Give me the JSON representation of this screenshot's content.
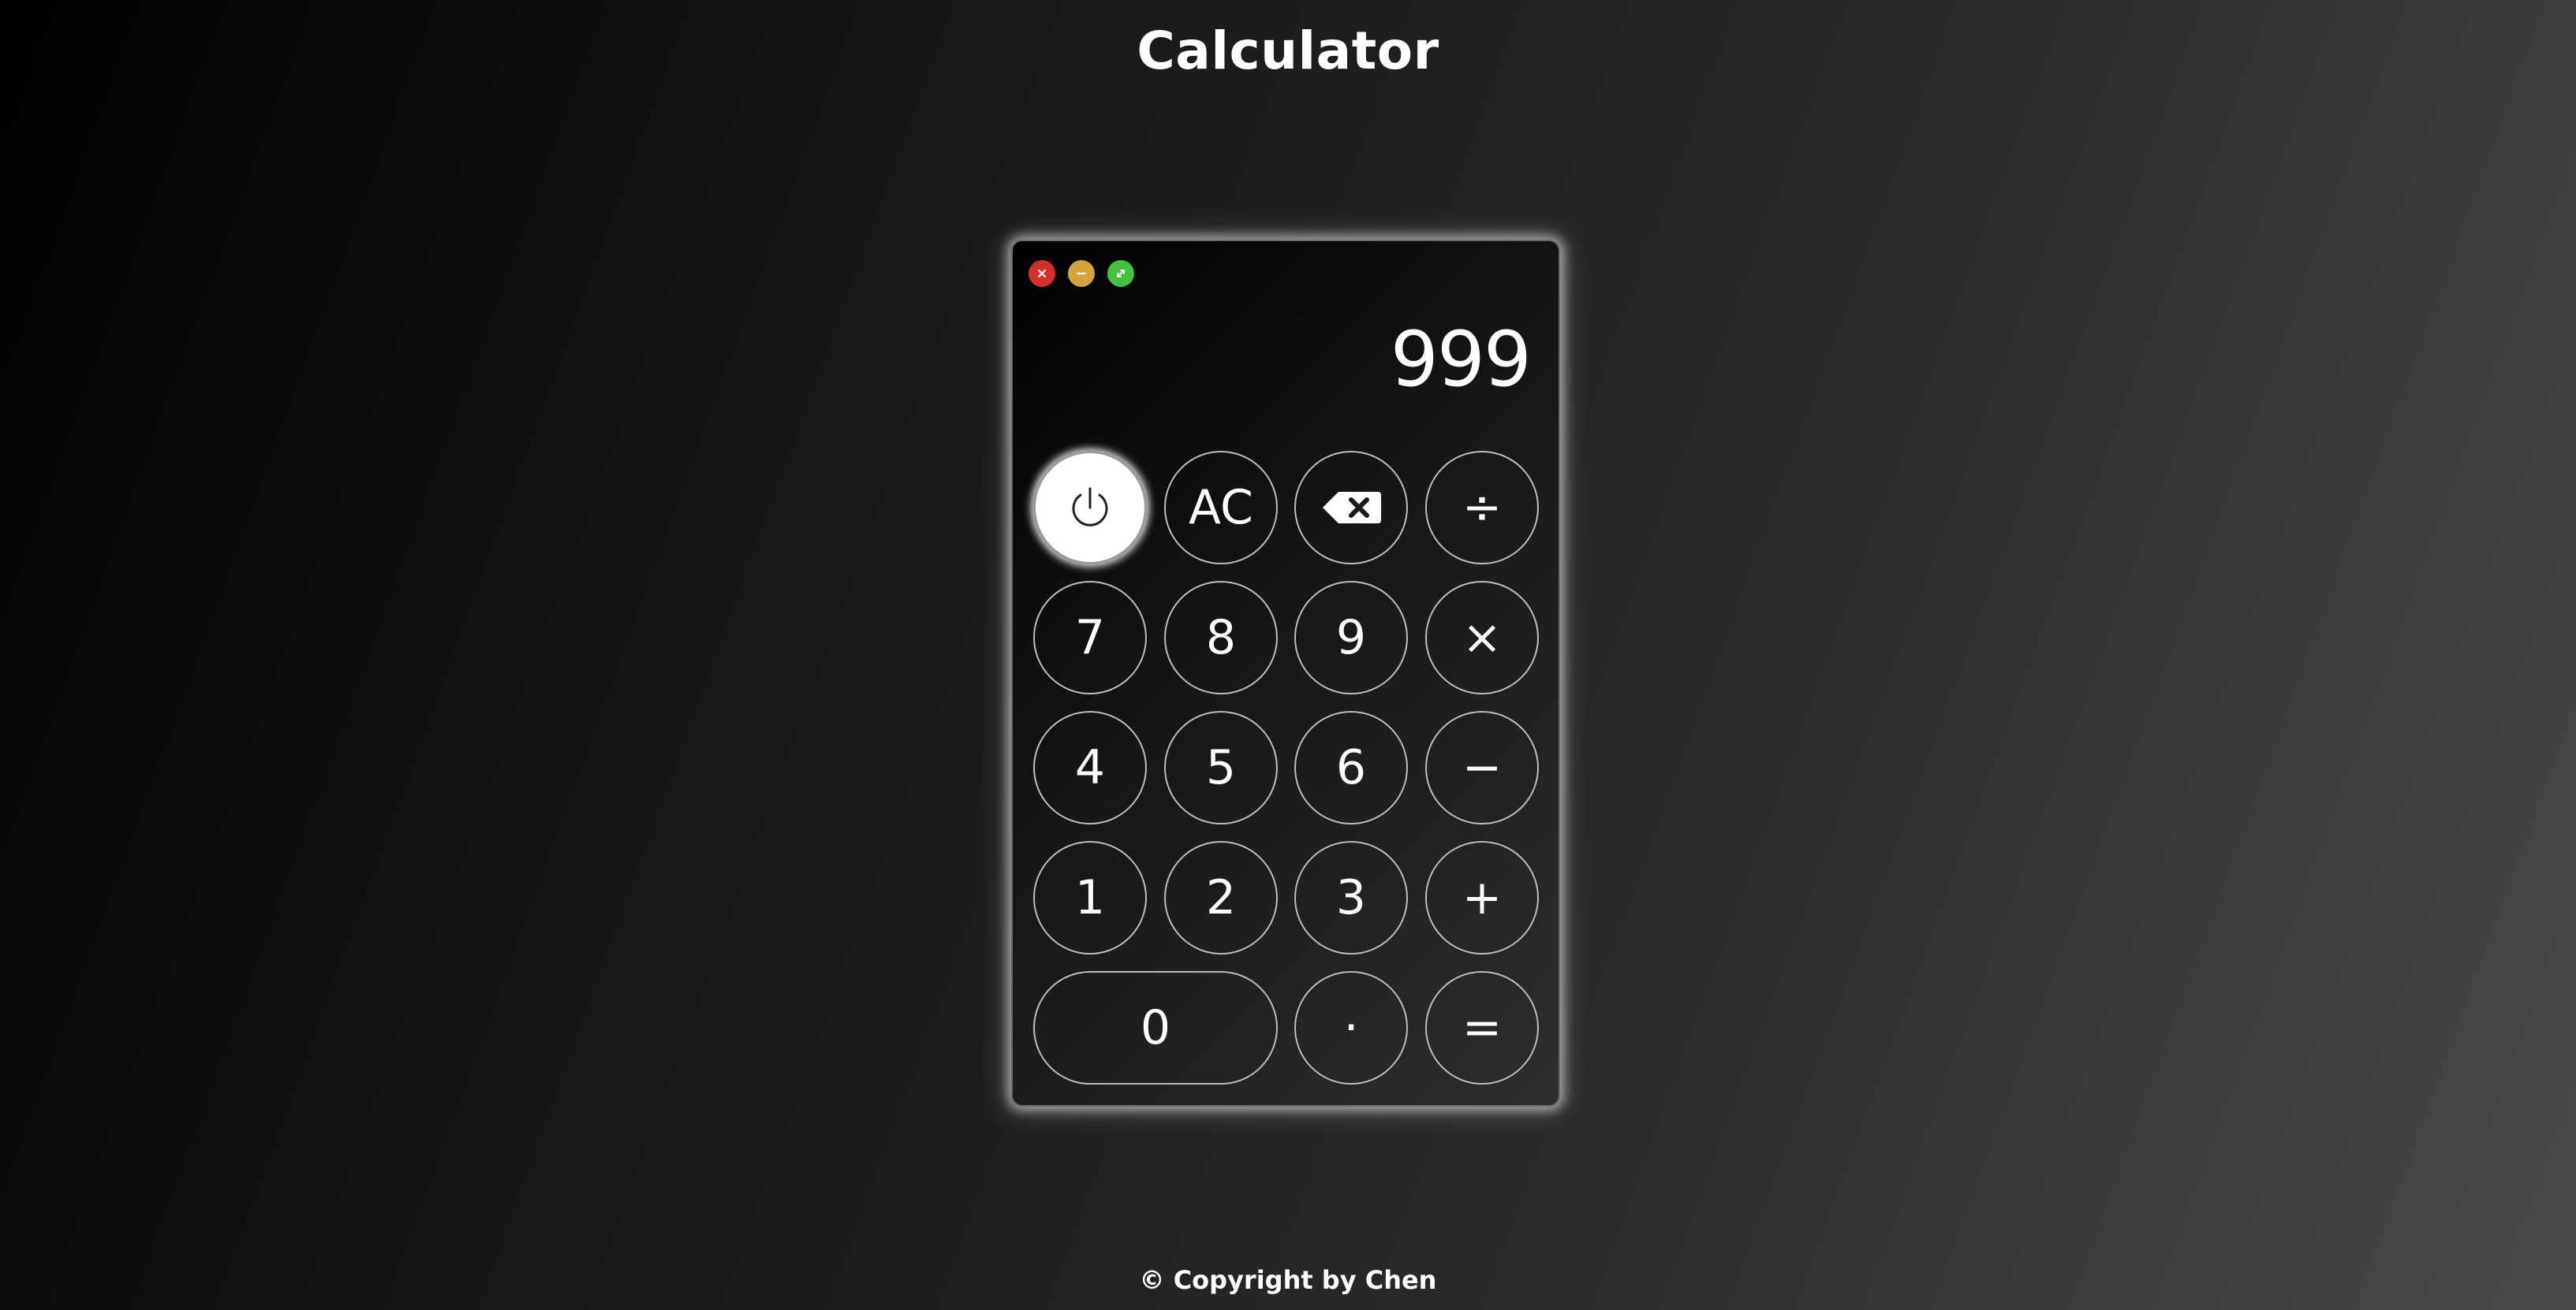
{
  "page": {
    "title": "Calculator",
    "footer": "© Copyright by Chen"
  },
  "window_controls": [
    {
      "name": "close",
      "icon": "close-icon",
      "color": "#d3302d"
    },
    {
      "name": "minimize",
      "icon": "minus-icon",
      "color": "#d5a53d"
    },
    {
      "name": "maximize",
      "icon": "expand-icon",
      "color": "#45c23d"
    }
  ],
  "display": {
    "value": "999"
  },
  "keys": {
    "power": {
      "icon": "power-icon",
      "state": "on"
    },
    "clear": "AC",
    "backspace": {
      "icon": "backspace-icon"
    },
    "divide": "÷",
    "seven": "7",
    "eight": "8",
    "nine": "9",
    "multiply": "×",
    "four": "4",
    "five": "5",
    "six": "6",
    "subtract": "−",
    "one": "1",
    "two": "2",
    "three": "3",
    "add": "+",
    "zero": "0",
    "decimal": "·",
    "equals": "="
  },
  "colors": {
    "key_border": "#bdbdbd",
    "active_key": "#ffffff",
    "text": "#ffffff"
  }
}
